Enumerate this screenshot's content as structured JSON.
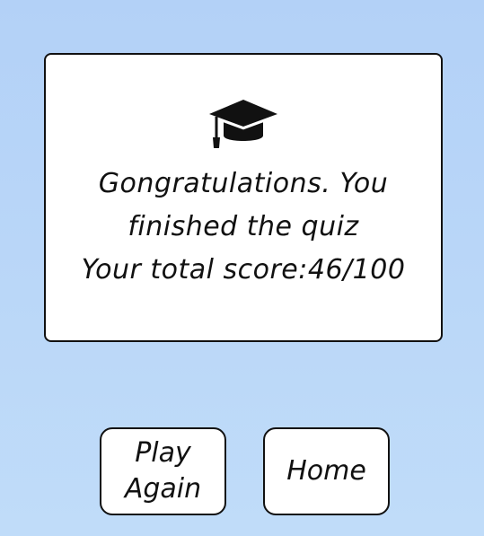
{
  "result": {
    "icon": "graduation-cap-icon",
    "line1": "Gongratulations. You",
    "line2": "finished the quiz",
    "line3": "Your total score:46/100"
  },
  "buttons": {
    "play_again_label": "Play Again",
    "home_label": "Home"
  },
  "colors": {
    "background": "#b3d1f7",
    "card": "#ffffff",
    "text": "#111111"
  }
}
